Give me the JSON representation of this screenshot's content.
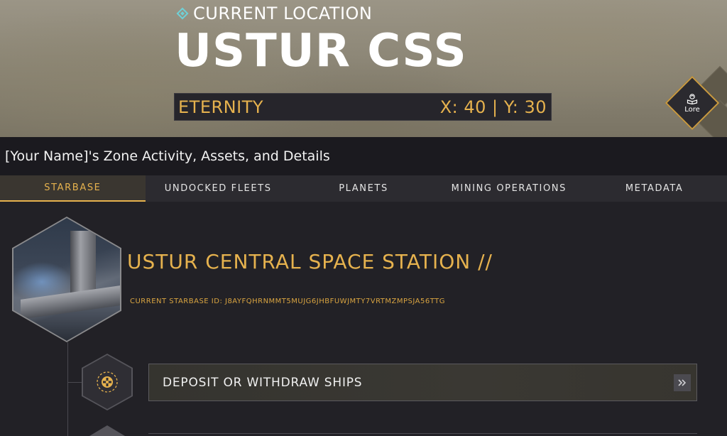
{
  "hero": {
    "label": "CURRENT LOCATION",
    "name": "USTUR CSS",
    "region": "ETERNITY",
    "coordinates": "X: 40 | Y: 30",
    "lore_label": "Lore"
  },
  "subheader": {
    "title": "[Your Name]'s Zone Activity, Assets, and Details"
  },
  "tabs": [
    {
      "label": "STARBASE",
      "active": true
    },
    {
      "label": "UNDOCKED FLEETS",
      "active": false
    },
    {
      "label": "PLANETS",
      "active": false
    },
    {
      "label": "MINING OPERATIONS",
      "active": false
    },
    {
      "label": "METADATA",
      "active": false
    }
  ],
  "starbase": {
    "title": "USTUR CENTRAL SPACE STATION //",
    "id_label": "CURRENT STARBASE ID: J8AYFQHRNMMT5MUJG6JHBFUWJMTY7VRTMZMPSJA56TTG",
    "action_label": "DEPOSIT OR WITHDRAW SHIPS"
  },
  "colors": {
    "accent": "#e6b24e",
    "teal": "#6fd0d6",
    "background": "#222126"
  },
  "icons": {
    "location": "diamond-location-icon",
    "lore": "book-icon",
    "action": "ship-target-icon",
    "chevron": "double-chevron-right-icon"
  }
}
